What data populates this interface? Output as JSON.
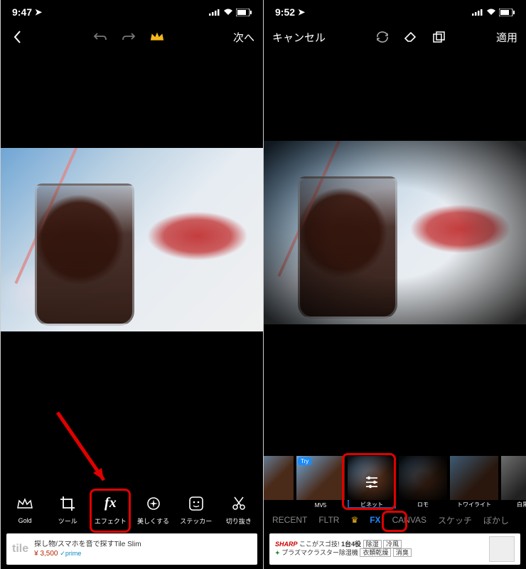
{
  "left": {
    "status": {
      "time": "9:47",
      "loc": "◤"
    },
    "topbar": {
      "next": "次へ"
    },
    "tools": [
      {
        "name": "Gold",
        "icon": "crown"
      },
      {
        "name": "ツール",
        "icon": "crop"
      },
      {
        "name": "エフェクト",
        "icon": "fx"
      },
      {
        "name": "美しくする",
        "icon": "sparkle"
      },
      {
        "name": "ステッカー",
        "icon": "smiley"
      },
      {
        "name": "切り抜き",
        "icon": "scissors"
      }
    ],
    "ad": {
      "logo": "tile",
      "line1": "探し物/スマホを音で探すTile Slim",
      "price": "¥ 3,500",
      "prime": "✓prime"
    }
  },
  "right": {
    "status": {
      "time": "9:52",
      "loc": "◤"
    },
    "topbar": {
      "cancel": "キャンセル",
      "apply": "適用"
    },
    "effects": [
      {
        "name": "",
        "try": true
      },
      {
        "name": "MV5",
        "try": true
      },
      {
        "name": "ビネット",
        "selected": true
      },
      {
        "name": "ロモ"
      },
      {
        "name": "トワイライト"
      },
      {
        "name": "白黒ク"
      }
    ],
    "categories": [
      {
        "name": "RECENT"
      },
      {
        "name": "FLTR"
      },
      {
        "name": "👑",
        "crown": true
      },
      {
        "name": "FX",
        "active": true
      },
      {
        "name": "CANVAS"
      },
      {
        "name": "スケッチ"
      },
      {
        "name": "ぼかし"
      }
    ],
    "ad": {
      "brand": "SHARP",
      "tagline": "ここがスゴ技!",
      "headline": "1台4役",
      "sub": "プラズマクラスター除湿機",
      "tags": [
        "除湿",
        "冷風",
        "衣類乾燥",
        "消臭"
      ]
    }
  }
}
